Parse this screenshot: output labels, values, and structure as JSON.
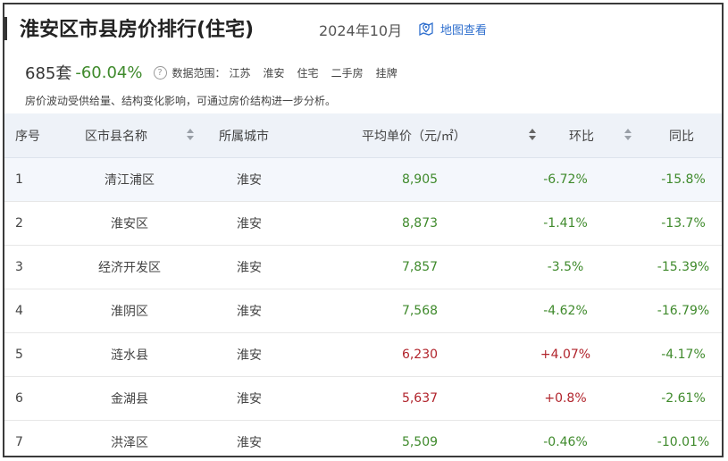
{
  "header": {
    "title": "淮安区市县房价排行(住宅)",
    "date": "2024年10月",
    "map_link": "地图查看"
  },
  "stats": {
    "count": "685套",
    "change": "-60.04%",
    "scope_label": "数据范围：",
    "scope_tags": [
      "江苏",
      "淮安",
      "住宅",
      "二手房",
      "挂牌"
    ]
  },
  "note": "房价波动受供给量、结构变化影响，可通过房价结构进一步分析。",
  "table": {
    "columns": [
      "序号",
      "区市县名称",
      "所属城市",
      "平均单价（元/㎡）",
      "环比",
      "同比"
    ],
    "rows": [
      {
        "idx": "1",
        "name": "清江浦区",
        "city": "淮安",
        "price": "8,905",
        "mom": "-6.72%",
        "yoy": "-15.8%"
      },
      {
        "idx": "2",
        "name": "淮安区",
        "city": "淮安",
        "price": "8,873",
        "mom": "-1.41%",
        "yoy": "-13.7%"
      },
      {
        "idx": "3",
        "name": "经济开发区",
        "city": "淮安",
        "price": "7,857",
        "mom": "-3.5%",
        "yoy": "-15.39%"
      },
      {
        "idx": "4",
        "name": "淮阴区",
        "city": "淮安",
        "price": "7,568",
        "mom": "-4.62%",
        "yoy": "-16.79%"
      },
      {
        "idx": "5",
        "name": "涟水县",
        "city": "淮安",
        "price": "6,230",
        "mom": "+4.07%",
        "yoy": "-4.17%"
      },
      {
        "idx": "6",
        "name": "金湖县",
        "city": "淮安",
        "price": "5,637",
        "mom": "+0.8%",
        "yoy": "-2.61%"
      },
      {
        "idx": "7",
        "name": "洪泽区",
        "city": "淮安",
        "price": "5,509",
        "mom": "-0.46%",
        "yoy": "-10.01%"
      }
    ]
  },
  "colors": {
    "positive": "#b1242c",
    "negative": "#3f8a2c",
    "link": "#2f6fce",
    "header_bg": "#eef2f8"
  }
}
